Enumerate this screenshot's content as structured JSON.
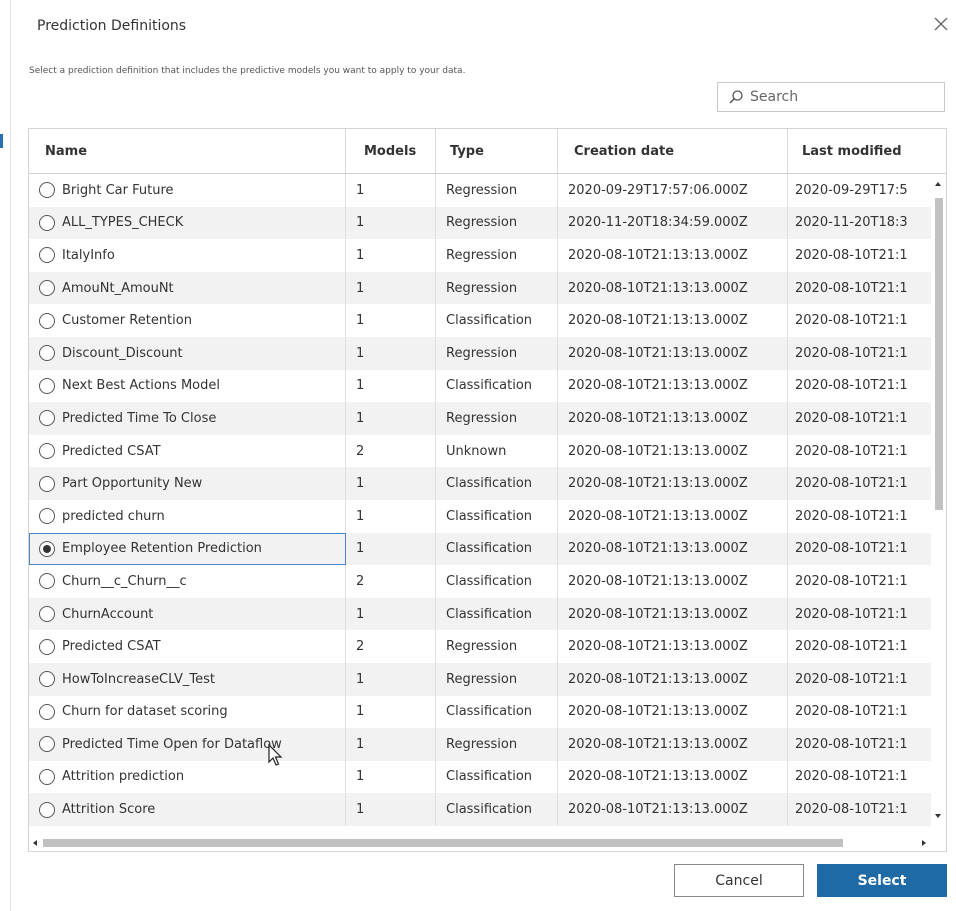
{
  "dialog": {
    "title": "Prediction Definitions",
    "description": "Select a prediction definition that includes the predictive models you want to apply to your data.",
    "close_icon": "close-icon"
  },
  "search": {
    "placeholder": "Search",
    "value": "",
    "icon": "search-icon"
  },
  "table": {
    "columns": [
      "Name",
      "Models",
      "Type",
      "Creation date",
      "Last modified"
    ],
    "rows": [
      {
        "name": "Bright Car Future",
        "models": "1",
        "type": "Regression",
        "created": "2020-09-29T17:57:06.000Z",
        "modified": "2020-09-29T17:5",
        "selected": false
      },
      {
        "name": "ALL_TYPES_CHECK",
        "models": "1",
        "type": "Regression",
        "created": "2020-11-20T18:34:59.000Z",
        "modified": "2020-11-20T18:3",
        "selected": false
      },
      {
        "name": "ItalyInfo",
        "models": "1",
        "type": "Regression",
        "created": "2020-08-10T21:13:13.000Z",
        "modified": "2020-08-10T21:1",
        "selected": false
      },
      {
        "name": "AmouNt_AmouNt",
        "models": "1",
        "type": "Regression",
        "created": "2020-08-10T21:13:13.000Z",
        "modified": "2020-08-10T21:1",
        "selected": false
      },
      {
        "name": "Customer Retention",
        "models": "1",
        "type": "Classification",
        "created": "2020-08-10T21:13:13.000Z",
        "modified": "2020-08-10T21:1",
        "selected": false
      },
      {
        "name": "Discount_Discount",
        "models": "1",
        "type": "Regression",
        "created": "2020-08-10T21:13:13.000Z",
        "modified": "2020-08-10T21:1",
        "selected": false
      },
      {
        "name": "Next Best Actions Model",
        "models": "1",
        "type": "Classification",
        "created": "2020-08-10T21:13:13.000Z",
        "modified": "2020-08-10T21:1",
        "selected": false
      },
      {
        "name": "Predicted Time To Close",
        "models": "1",
        "type": "Regression",
        "created": "2020-08-10T21:13:13.000Z",
        "modified": "2020-08-10T21:1",
        "selected": false
      },
      {
        "name": "Predicted CSAT",
        "models": "2",
        "type": "Unknown",
        "created": "2020-08-10T21:13:13.000Z",
        "modified": "2020-08-10T21:1",
        "selected": false
      },
      {
        "name": "Part Opportunity New",
        "models": "1",
        "type": "Classification",
        "created": "2020-08-10T21:13:13.000Z",
        "modified": "2020-08-10T21:1",
        "selected": false
      },
      {
        "name": "predicted churn",
        "models": "1",
        "type": "Classification",
        "created": "2020-08-10T21:13:13.000Z",
        "modified": "2020-08-10T21:1",
        "selected": false
      },
      {
        "name": "Employee Retention Prediction",
        "models": "1",
        "type": "Classification",
        "created": "2020-08-10T21:13:13.000Z",
        "modified": "2020-08-10T21:1",
        "selected": true
      },
      {
        "name": "Churn__c_Churn__c",
        "models": "2",
        "type": "Classification",
        "created": "2020-08-10T21:13:13.000Z",
        "modified": "2020-08-10T21:1",
        "selected": false
      },
      {
        "name": "ChurnAccount",
        "models": "1",
        "type": "Classification",
        "created": "2020-08-10T21:13:13.000Z",
        "modified": "2020-08-10T21:1",
        "selected": false
      },
      {
        "name": "Predicted CSAT",
        "models": "2",
        "type": "Regression",
        "created": "2020-08-10T21:13:13.000Z",
        "modified": "2020-08-10T21:1",
        "selected": false
      },
      {
        "name": "HowToIncreaseCLV_Test",
        "models": "1",
        "type": "Regression",
        "created": "2020-08-10T21:13:13.000Z",
        "modified": "2020-08-10T21:1",
        "selected": false
      },
      {
        "name": "Churn for dataset scoring",
        "models": "1",
        "type": "Classification",
        "created": "2020-08-10T21:13:13.000Z",
        "modified": "2020-08-10T21:1",
        "selected": false
      },
      {
        "name": "Predicted Time Open for Dataflow",
        "models": "1",
        "type": "Regression",
        "created": "2020-08-10T21:13:13.000Z",
        "modified": "2020-08-10T21:1",
        "selected": false
      },
      {
        "name": "Attrition prediction",
        "models": "1",
        "type": "Classification",
        "created": "2020-08-10T21:13:13.000Z",
        "modified": "2020-08-10T21:1",
        "selected": false
      },
      {
        "name": "Attrition Score",
        "models": "1",
        "type": "Classification",
        "created": "2020-08-10T21:13:13.000Z",
        "modified": "2020-08-10T21:1",
        "selected": false
      }
    ]
  },
  "footer": {
    "cancel_label": "Cancel",
    "select_label": "Select"
  },
  "colors": {
    "accent": "#1f6aa5",
    "selection_outline": "#4a86c5",
    "row_alt": "#f2f2f2"
  }
}
